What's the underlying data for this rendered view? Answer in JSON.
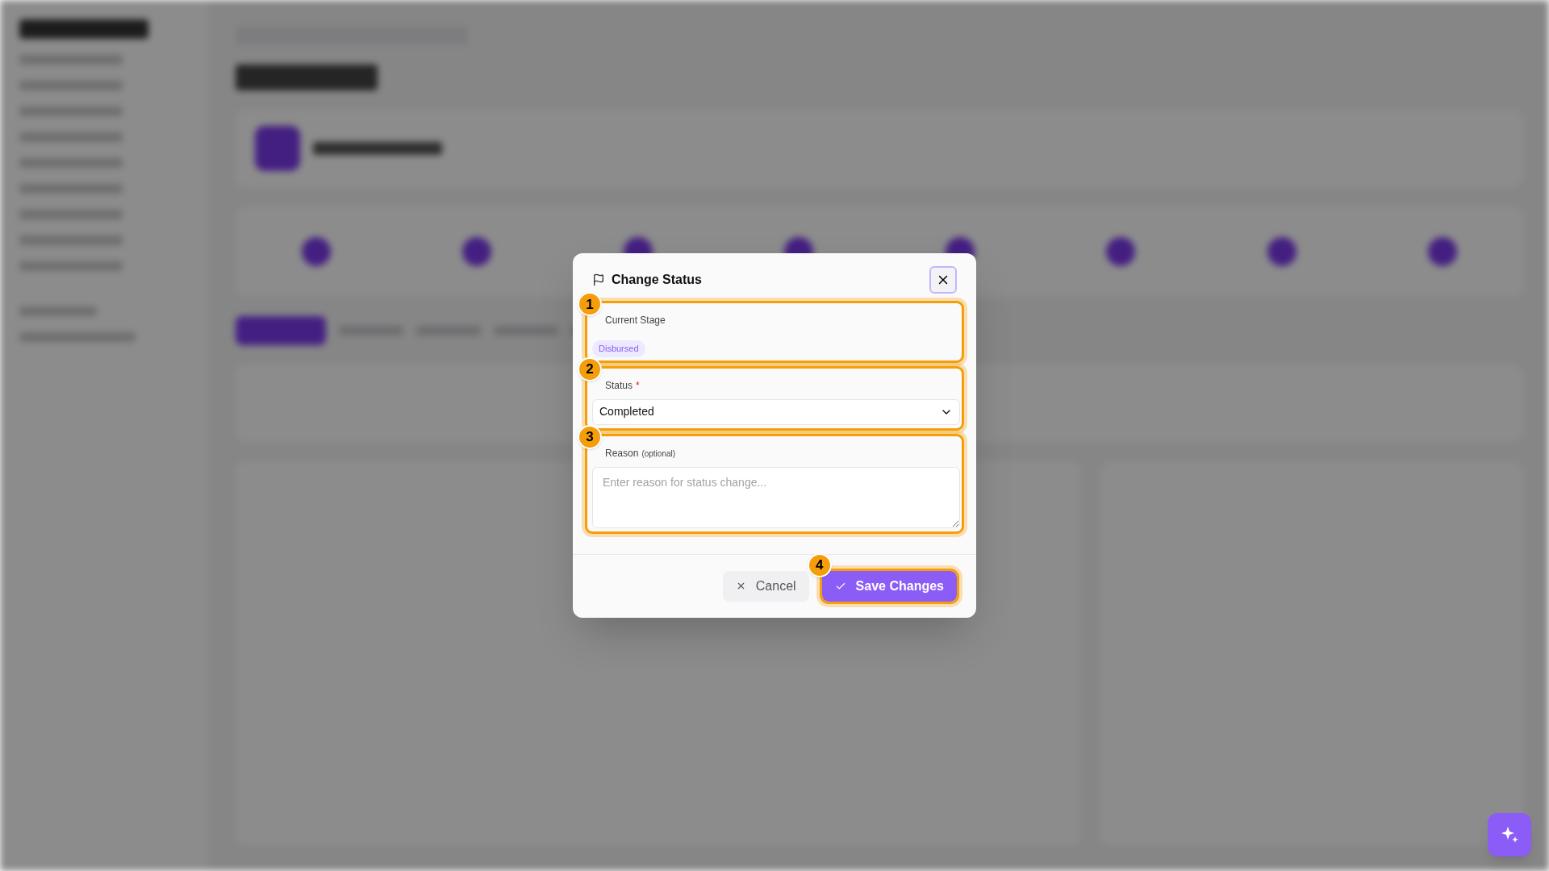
{
  "dialog": {
    "title": "Change Status",
    "fields": [
      {
        "kind": "badge",
        "label": "Current Stage",
        "value": "Disbursed",
        "callout": "1"
      },
      {
        "kind": "select",
        "label": "Status",
        "required_mark": "*",
        "value": "Completed",
        "callout": "2"
      },
      {
        "kind": "textarea",
        "label": "Reason",
        "hint": "(optional)",
        "placeholder": "Enter reason for status change...",
        "callout": "3"
      }
    ],
    "buttons": [
      {
        "kind": "secondary",
        "label": "Cancel"
      },
      {
        "kind": "primary",
        "label": "Save Changes",
        "callout": "4"
      }
    ]
  }
}
